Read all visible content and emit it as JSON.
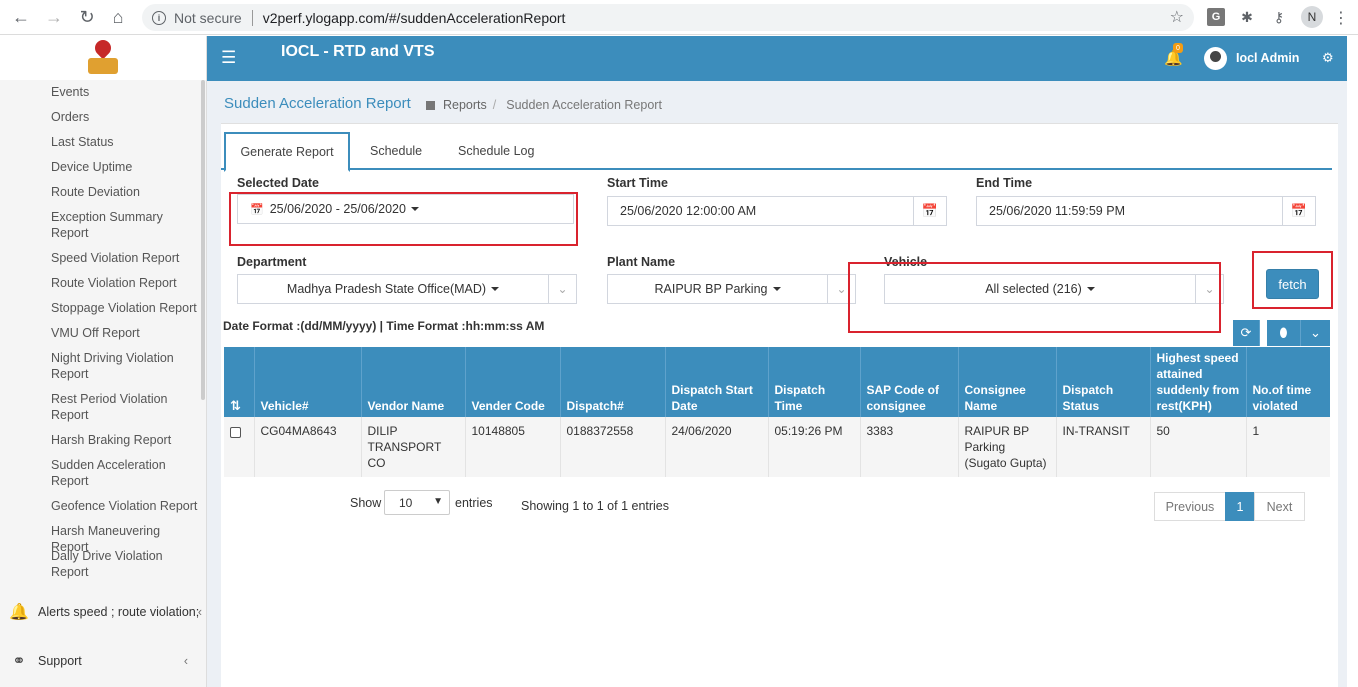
{
  "browser": {
    "security": "Not secure",
    "url": "v2perf.ylogapp.com/#/suddenAccelerationReport",
    "profile_initial": "N",
    "ext_g": "G"
  },
  "sidebar": {
    "items": [
      {
        "label": "Events"
      },
      {
        "label": "Orders"
      },
      {
        "label": "Last Status"
      },
      {
        "label": "Device Uptime"
      },
      {
        "label": "Route Deviation"
      },
      {
        "label": "Exception Summary Report"
      },
      {
        "label": "Speed Violation Report"
      },
      {
        "label": "Route Violation Report"
      },
      {
        "label": "Stoppage Violation Report"
      },
      {
        "label": "VMU Off Report"
      },
      {
        "label": "Night Driving Violation Report"
      },
      {
        "label": "Rest Period Violation Report"
      },
      {
        "label": "Harsh Braking Report"
      },
      {
        "label": "Sudden Acceleration Report"
      },
      {
        "label": "Geofence Violation Report"
      },
      {
        "label": "Harsh Maneuvering Report"
      },
      {
        "label": "Daily Drive Violation Report"
      }
    ],
    "alerts_label": "Alerts speed ; route violation;",
    "support_label": "Support"
  },
  "header": {
    "title": "IOCL - RTD and VTS",
    "notif_count": "0",
    "user": "Iocl Admin"
  },
  "page": {
    "title": "Sudden Acceleration Report",
    "breadcrumb": [
      "Reports",
      "Sudden Acceleration Report"
    ]
  },
  "tabs": [
    "Generate Report",
    "Schedule",
    "Schedule Log"
  ],
  "form": {
    "selected_date_label": "Selected Date",
    "selected_date_value": "25/06/2020 - 25/06/2020",
    "start_time_label": "Start Time",
    "start_time_value": "25/06/2020 12:00:00 AM",
    "end_time_label": "End Time",
    "end_time_value": "25/06/2020 11:59:59 PM",
    "department_label": "Department",
    "department_value": "Madhya Pradesh State Office(MAD)",
    "plant_label": "Plant Name",
    "plant_value": "RAIPUR BP Parking",
    "vehicle_label": "Vehicle",
    "vehicle_value": "All selected (216)",
    "fetch_label": "fetch",
    "format_note": "Date Format :(dd/MM/yyyy) | Time Format :hh:mm:ss AM"
  },
  "table": {
    "columns": [
      "Vehicle#",
      "Vendor Name",
      "Vender Code",
      "Dispatch#",
      "Dispatch Start Date",
      "Dispatch Time",
      "SAP Code of consignee",
      "Consignee Name",
      "Dispatch Status",
      "Highest speed attained suddenly from rest(KPH)",
      "No.of time violated"
    ],
    "rows": [
      [
        "CG04MA8643",
        "DILIP TRANSPORT CO",
        "10148805",
        "0188372558",
        "24/06/2020",
        "05:19:26 PM",
        "3383",
        "RAIPUR BP Parking (Sugato Gupta)",
        "IN-TRANSIT",
        "50",
        "1"
      ]
    ]
  },
  "footer": {
    "show_label": "Show",
    "page_length": "10",
    "entries_label": "entries",
    "info": "Showing 1 to 1 of 1 entries",
    "prev": "Previous",
    "current_page": "1",
    "next": "Next"
  }
}
